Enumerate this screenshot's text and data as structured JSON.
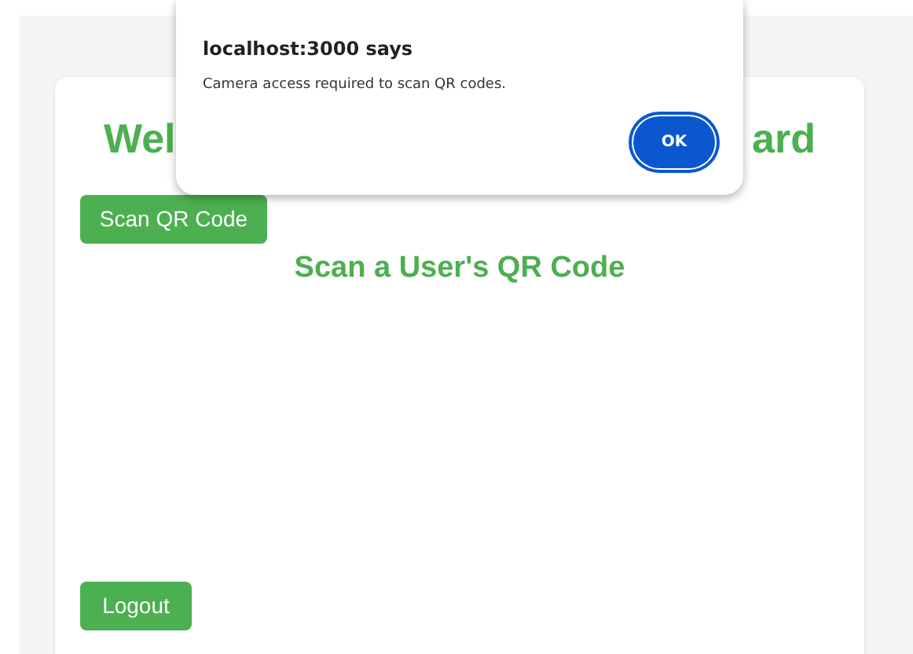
{
  "page": {
    "heading_left": "Wel",
    "heading_right": "ard",
    "scan_button": "Scan QR Code",
    "subheading": "Scan a User's QR Code",
    "logout_button": "Logout"
  },
  "dialog": {
    "title": "localhost:3000 says",
    "message": "Camera access required to scan QR codes.",
    "ok_button": "OK"
  }
}
